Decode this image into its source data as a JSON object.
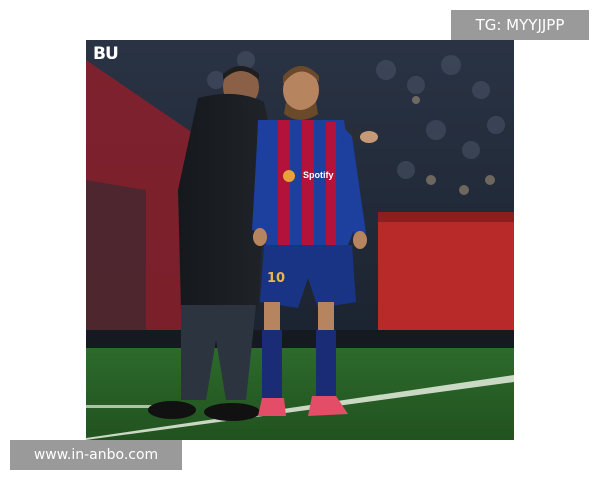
{
  "photo": {
    "logo_text": "BU",
    "sponsor_text": "Spotify",
    "shirt_number": "10"
  },
  "watermarks": {
    "top_right": "TG: MYYJJPP",
    "bottom_left": "www.in-anbo.com"
  },
  "colors": {
    "badge_background": "#9a9a9a",
    "badge_text": "#ffffff",
    "kit_blue": "#1d3f9e",
    "kit_red": "#b3123a",
    "pitch_green": "#2f6b2e"
  }
}
